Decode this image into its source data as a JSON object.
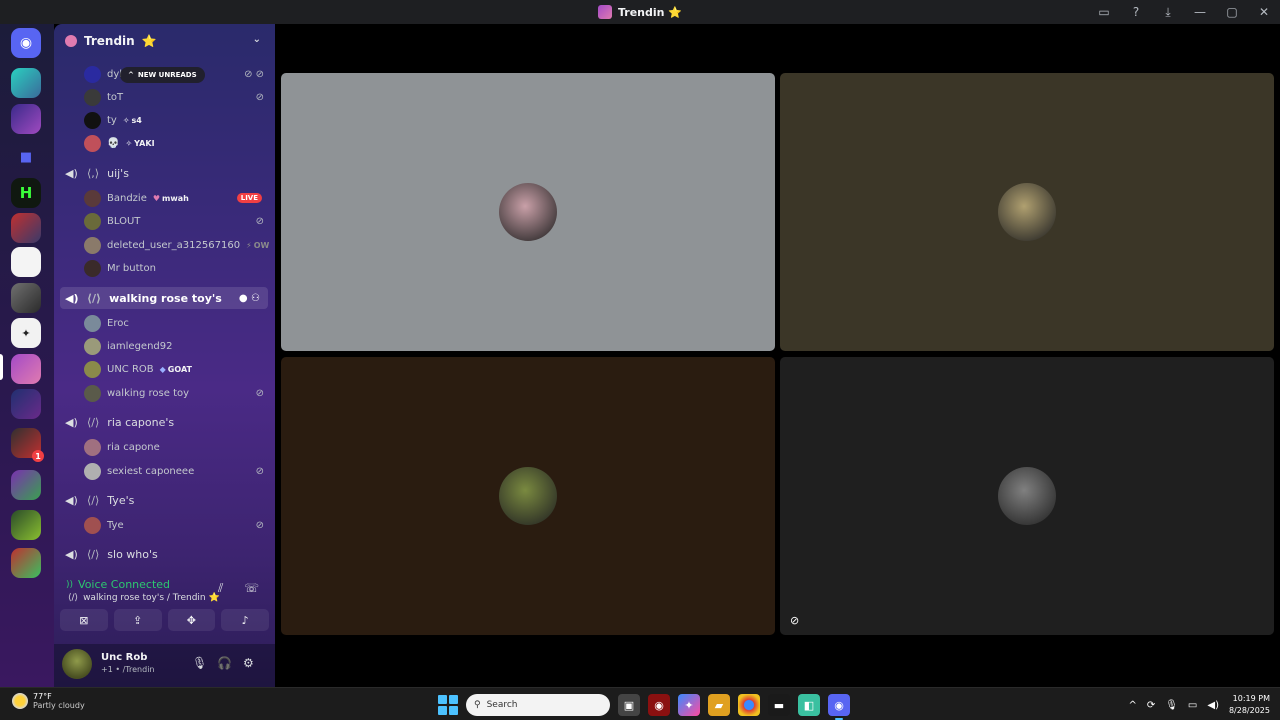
{
  "window": {
    "title": "Trendin ⭐",
    "buttons": [
      "inbox-icon",
      "help-icon",
      "download-icon",
      "minimize-icon",
      "maximize-icon",
      "close-icon"
    ]
  },
  "server": {
    "name": "Trendin",
    "star": "⭐",
    "new_unreads": "NEW UNREADS"
  },
  "top_users": [
    {
      "name": "dyl",
      "tag": "",
      "muted": true,
      "deafened": true,
      "color": "#2a2aa0"
    },
    {
      "name": "toT",
      "tag": "",
      "muted": true,
      "color": "#3a3a3a"
    },
    {
      "name": "ty",
      "tag": "s4",
      "muted": false,
      "color": "#111111"
    },
    {
      "name": "💀",
      "tag": "YAKI",
      "muted": false,
      "color": "#c0505a"
    }
  ],
  "channels": [
    {
      "name": "uij's",
      "active": false,
      "users": [
        {
          "name": "Bandzie",
          "tag": "mwah",
          "live": "LIVE",
          "muted": false,
          "color": "#5a3a3a"
        },
        {
          "name": "BLOUT",
          "tag": "",
          "muted": true,
          "color": "#6a6a3a"
        },
        {
          "name": "deleted_user_a312567160",
          "tag": "OW",
          "muted": false,
          "color": "#8a7a6a"
        },
        {
          "name": "Mr button",
          "tag": "",
          "muted": false,
          "color": "#3a2a2a"
        }
      ]
    },
    {
      "name": "walking rose toy's",
      "active": true,
      "users": [
        {
          "name": "Eroc",
          "tag": "",
          "muted": false,
          "color": "#7a8a9a"
        },
        {
          "name": "iamlegend92",
          "tag": "",
          "muted": false,
          "color": "#9a9a7a"
        },
        {
          "name": "UNC ROB",
          "tag": "GOAT",
          "muted": false,
          "color": "#8a8a4a"
        },
        {
          "name": "walking rose toy",
          "tag": "",
          "muted": true,
          "color": "#5a5a4a"
        }
      ]
    },
    {
      "name": "ria capone's",
      "active": false,
      "users": [
        {
          "name": "ria capone",
          "tag": "",
          "muted": false,
          "color": "#a07080"
        },
        {
          "name": "sexiest caponeee",
          "tag": "",
          "muted": true,
          "color": "#b0b0b0"
        }
      ]
    },
    {
      "name": "Tye's",
      "active": false,
      "users": [
        {
          "name": "Tye",
          "tag": "",
          "muted": true,
          "color": "#a05050"
        }
      ]
    },
    {
      "name": "slo who's",
      "active": false,
      "users": []
    }
  ],
  "voice": {
    "status": "Voice Connected",
    "location": "walking rose toy's / Trendin ⭐"
  },
  "user": {
    "name": "Unc Rob",
    "status": "+1 • /Trendin"
  },
  "tiles": [
    {
      "bg": "#8f9396",
      "face": "#c9a0a8"
    },
    {
      "bg": "#3b3627",
      "face": "#b0a070"
    },
    {
      "bg": "#2a1c10",
      "face": "#7a8a40"
    },
    {
      "bg": "#1f1f1f",
      "face": "#808080",
      "muted": true
    }
  ],
  "taskbar": {
    "temp": "77°F",
    "condition": "Partly cloudy",
    "search": "Search",
    "time": "10:19 PM",
    "date": "8/28/2025"
  },
  "rail_badges": [
    "1"
  ]
}
